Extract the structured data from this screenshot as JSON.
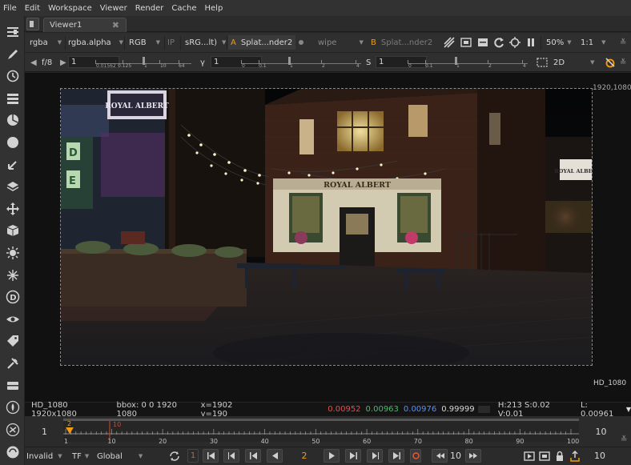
{
  "menu": [
    "File",
    "Edit",
    "Workspace",
    "Viewer",
    "Render",
    "Cache",
    "Help"
  ],
  "tab": {
    "title": "Viewer1",
    "close": "✖"
  },
  "viewer_controls": {
    "channels": "rgba",
    "channel_alpha": "rgba.alpha",
    "colorspace": "RGB",
    "ip_label": "IP",
    "lut": "sRG...lt)",
    "input_a_label": "A",
    "input_a": "Splat...nder2",
    "wipe": "wipe",
    "input_b_label": "B",
    "input_b": "Splat...nder2",
    "zoom": "50%",
    "ratio": "1:1"
  },
  "grade_controls": {
    "fstop": "f/8",
    "gain_value": "1",
    "gain_ticks": [
      "0.01562",
      "0.125",
      "1",
      "10",
      "64"
    ],
    "gamma_label": "γ",
    "gamma_value": "1",
    "gamma_ticks": [
      "0",
      "0.1",
      "1",
      "2",
      "4"
    ],
    "saturation_label": "S",
    "saturation_value": "1",
    "saturation_ticks": [
      "0",
      "0.1",
      "1",
      "2",
      "4"
    ],
    "view_mode": "2D"
  },
  "viewport": {
    "format_top": "1920,1080",
    "format_bottom": "HD_1080",
    "image_content": {
      "pub_sign": "ROYAL ALBERT",
      "fascia": "ROYAL ALBERT",
      "side_sign": "ROYAL ALBERT",
      "wall_letters": [
        "D",
        "E"
      ]
    }
  },
  "info": {
    "format": "HD_1080 1920x1080",
    "bbox": "bbox: 0 0 1920 1080",
    "coords": "x=1902 y=190",
    "r": "0.00952",
    "g": "0.00963",
    "b": "0.00976",
    "a": "0.99999",
    "hsv": "H:213 S:0.02 V:0.01",
    "luma": "L: 0.00961"
  },
  "timeline": {
    "start_frame": "1",
    "end_frame": "10",
    "ruler_labels": [
      "1",
      "10",
      "20",
      "30",
      "40",
      "50",
      "60",
      "70",
      "80",
      "90",
      "100"
    ],
    "current_frame_marker": "2",
    "out_marker": "10"
  },
  "transport": {
    "invalid": "Invalid",
    "tf": "TF",
    "global": "Global",
    "frame_increment": "1",
    "current_frame": "2",
    "step": "10",
    "end_frame": "10"
  },
  "colors": {
    "accent": "#f39c12",
    "red": "#e05050",
    "green": "#40c060",
    "blue": "#5a8ef0",
    "timeline_red": "#d04a2a"
  }
}
